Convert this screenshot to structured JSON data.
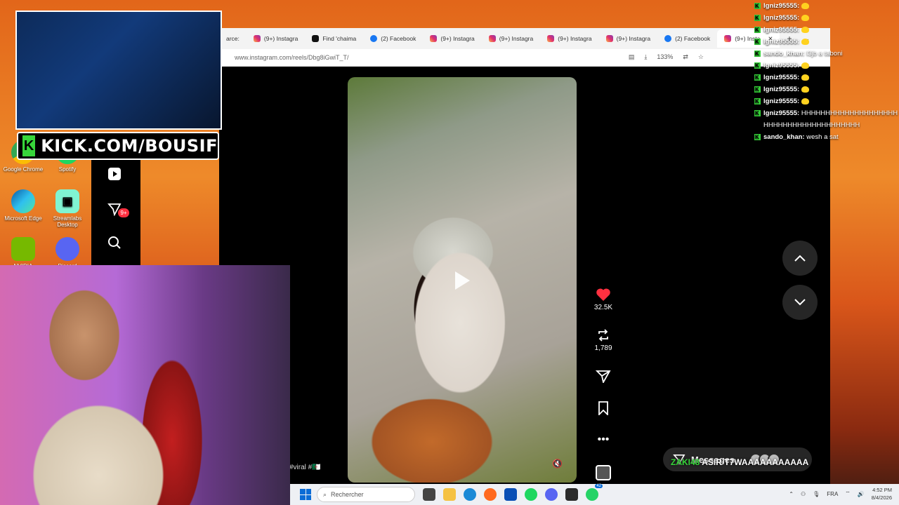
{
  "desktop": {
    "icons": [
      {
        "label": "Google Chrome"
      },
      {
        "label": "Spotify"
      },
      {
        "label": "Microsoft Edge"
      },
      {
        "label": "Streamlabs Desktop"
      },
      {
        "label": "NVIDIA"
      },
      {
        "label": "Discord"
      }
    ]
  },
  "browser": {
    "tabs": [
      {
        "label": "arce:"
      },
      {
        "label": "(9+) Instagra"
      },
      {
        "label": "Find 'chaima"
      },
      {
        "label": "(2) Facebook"
      },
      {
        "label": "(9+) Instagra"
      },
      {
        "label": "(9+) Instagra"
      },
      {
        "label": "(9+) Instagra"
      },
      {
        "label": "(9+) Instagra"
      },
      {
        "label": "(2) Facebook"
      },
      {
        "label": "(9+) Insta"
      }
    ],
    "url": "www.instagram.com/reels/Dbg8iGwiT_T/",
    "zoom": "133%"
  },
  "sidebar": {
    "notification_badge": "9+"
  },
  "reel": {
    "caption": "#viral #🇩🇿",
    "likes": "32.5K",
    "reposts": "1,789"
  },
  "messages": {
    "label": "Messages"
  },
  "overlay_message": {
    "user": "ZAKI48",
    "text": "ASIR T7WAAAAAAAAAAA"
  },
  "kick": {
    "banner": "KICK.COM/BOUSIF"
  },
  "chat": [
    {
      "user": "Igniz95555:",
      "text": "",
      "emoji": true
    },
    {
      "user": "Igniz95555:",
      "text": "",
      "emoji": true
    },
    {
      "user": "Igniz95555:",
      "text": "",
      "emoji": true
    },
    {
      "user": "Igniz95555:",
      "text": "",
      "emoji": true
    },
    {
      "user": "sando_khan:",
      "text": "l3jb a taboni",
      "emoji": false
    },
    {
      "user": "Igniz95555:",
      "text": "",
      "emoji": true
    },
    {
      "user": "Igniz95555:",
      "text": "",
      "emoji": true
    },
    {
      "user": "Igniz95555:",
      "text": "",
      "emoji": true
    },
    {
      "user": "Igniz95555:",
      "text": "",
      "emoji": true
    },
    {
      "user": "Igniz95555:",
      "text": "HHHHHHHHHHHHHHHHHHHHHHHHHHHHHHHHHHHHHHHH",
      "emoji": false
    },
    {
      "user": "sando_khan:",
      "text": "wesh a sat",
      "emoji": false
    }
  ],
  "taskbar": {
    "search_placeholder": "Rechercher",
    "language": "FRA",
    "time": "4:52 PM",
    "date": "8/4/2026",
    "teams_badge": "42"
  },
  "colors": {
    "kick_green": "#37d63a",
    "like_red": "#ff3040",
    "page_bg": "#000000"
  }
}
